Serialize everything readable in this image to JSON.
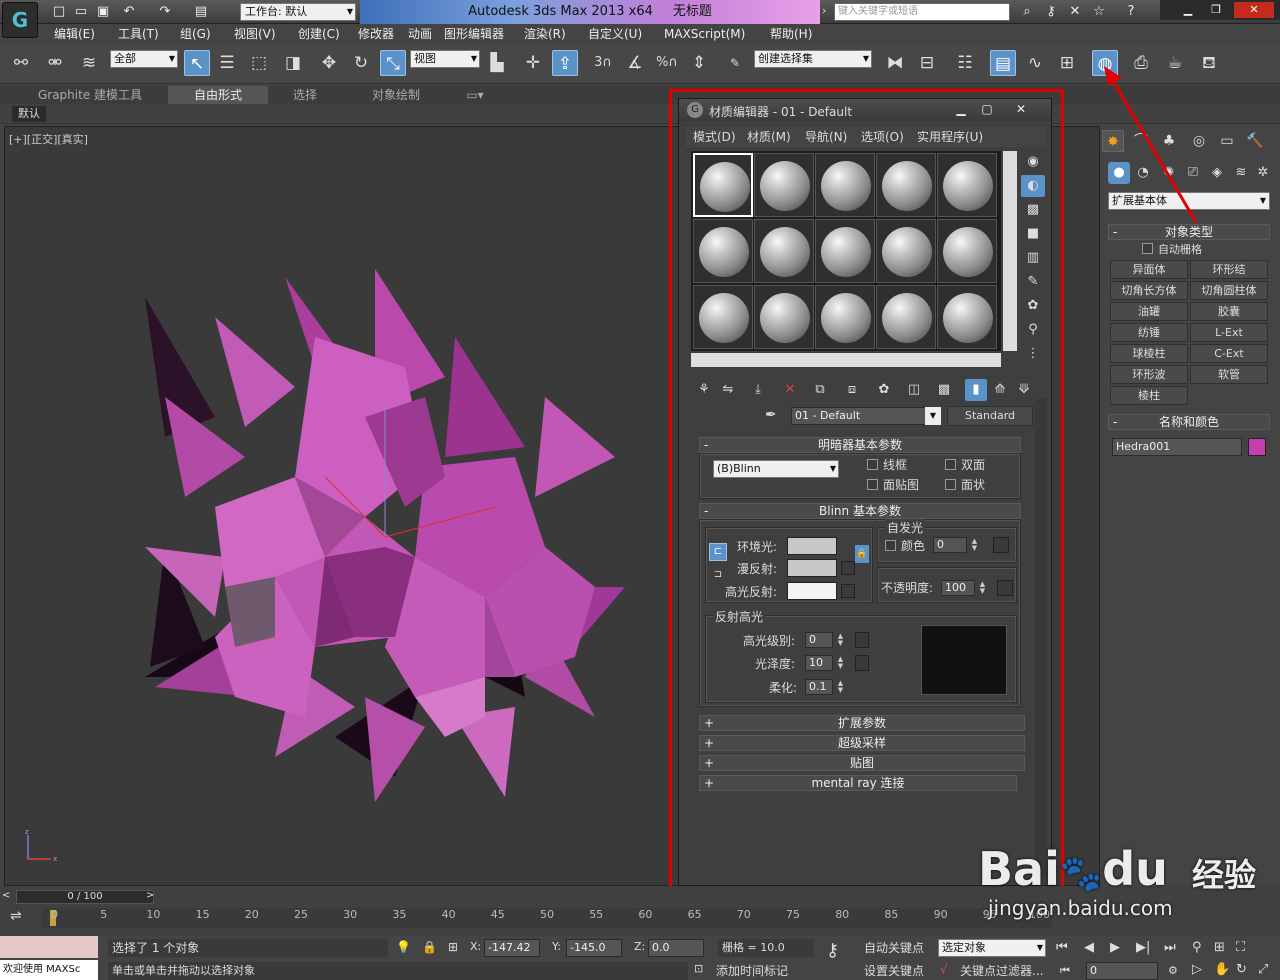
{
  "titlebar": {
    "workspace": "工作台: 默认",
    "app": "Autodesk 3ds Max  2013 x64",
    "document": "无标题",
    "search_placeholder": "键入关键字或短语"
  },
  "menubar": {
    "items": [
      "编辑(E)",
      "工具(T)",
      "组(G)",
      "视图(V)",
      "创建(C)",
      "修改器",
      "动画",
      "图形编辑器",
      "渲染(R)",
      "自定义(U)",
      "MAXScript(M)",
      "帮助(H)"
    ]
  },
  "toolbar": {
    "filter": "全部",
    "ref_coord": "视图",
    "snap3": "3",
    "percent": "%",
    "named_sel": "创建选择集"
  },
  "ribbon": {
    "tabs": [
      "Graphite 建模工具",
      "自由形式",
      "选择",
      "对象绘制"
    ],
    "sub_label": "默认"
  },
  "viewport": {
    "label": "[+][正交][真实]"
  },
  "material_editor": {
    "title": "材质编辑器 - 01 - Default",
    "menu": [
      "模式(D)",
      "材质(M)",
      "导航(N)",
      "选项(O)",
      "实用程序(U)"
    ],
    "material_name": "01 - Default",
    "material_type": "Standard",
    "shader_rollout": "明暗器基本参数",
    "shader": "(B)Blinn",
    "shader_options": {
      "wire": "线框",
      "two_sided": "双面",
      "face_map": "面贴图",
      "faceted": "面状"
    },
    "blinn_rollout": "Blinn 基本参数",
    "self_illum": {
      "title": "自发光",
      "color_label": "颜色",
      "value": "0"
    },
    "ambient_label": "环境光:",
    "diffuse_label": "漫反射:",
    "specular_label": "高光反射:",
    "opacity": {
      "label": "不透明度:",
      "value": "100"
    },
    "spec_highlights": {
      "title": "反射高光",
      "level_label": "高光级别:",
      "level": "0",
      "gloss_label": "光泽度:",
      "gloss": "10",
      "soften_label": "柔化:",
      "soften": "0.1"
    },
    "rollouts": [
      "扩展参数",
      "超级采样",
      "贴图",
      "mental ray 连接"
    ]
  },
  "command_panel": {
    "category": "扩展基本体",
    "object_type": {
      "title": "对象类型",
      "autogrid": "自动栅格",
      "buttons": [
        "异面体",
        "环形结",
        "切角长方体",
        "切角圆柱体",
        "油罐",
        "胶囊",
        "纺锤",
        "L-Ext",
        "球棱柱",
        "C-Ext",
        "环形波",
        "软管",
        "棱柱"
      ]
    },
    "name_color": {
      "title": "名称和颜色",
      "name": "Hedra001",
      "color": "#c040b0"
    }
  },
  "timeline": {
    "frame": "0 / 100",
    "ticks": [
      "0",
      "5",
      "10",
      "15",
      "20",
      "25",
      "30",
      "35",
      "40",
      "45",
      "50",
      "55",
      "60",
      "65",
      "70",
      "75",
      "80",
      "85",
      "90",
      "95",
      "100"
    ]
  },
  "status": {
    "maxscript": "欢迎使用 MAXSc",
    "selected": "选择了 1 个对象",
    "prompt": "单击或单击并拖动以选择对象",
    "x_label": "X:",
    "x": "-147.42",
    "y_label": "Y:",
    "y": "-145.0",
    "z_label": "Z:",
    "z": "0.0",
    "grid": "栅格 = 10.0",
    "add_time_tag": "添加时间标记",
    "auto_key": "自动关键点",
    "set_key": "设置关键点",
    "key_mode": "选定对象",
    "key_filters": "关键点过滤器...",
    "frame_field": "0"
  },
  "watermark": {
    "brand": "Bai",
    "brand2": "du",
    "jingyan": "经验",
    "url": "jingyan.baidu.com"
  },
  "colors": {
    "object": "#c040b0",
    "accent": "#5b93c8",
    "highlight_box": "#e00000"
  }
}
